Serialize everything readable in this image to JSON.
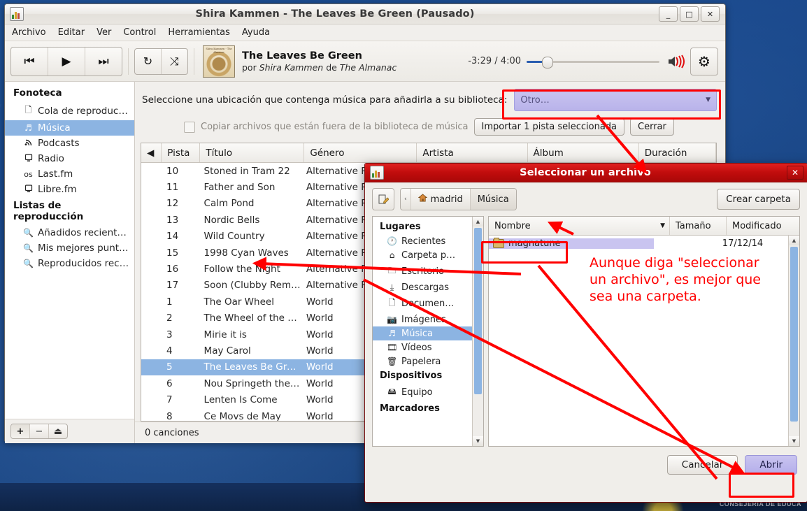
{
  "desktop": {
    "footer_text": "CONSEJERIA DE EDUCA"
  },
  "main_window": {
    "title": "Shira Kammen - The Leaves Be Green (Pausado)",
    "window_buttons": {
      "minimize": "_",
      "maximize": "□",
      "close": "✕"
    },
    "menu": [
      "Archivo",
      "Editar",
      "Ver",
      "Control",
      "Herramientas",
      "Ayuda"
    ],
    "toolbar": {
      "prev": "⏮",
      "play": "▶",
      "next": "⏭",
      "repeat": "↻",
      "shuffle": "⤨",
      "album_art_caption": "Shira Kammen - The Almanac",
      "now_playing_title": "The Leaves Be Green",
      "now_playing_by": "por",
      "now_playing_artist": "Shira Kammen",
      "now_playing_de": "de",
      "now_playing_album": "The Almanac",
      "time": "-3:29 / 4:00",
      "gear": "⚙"
    },
    "sidebar": {
      "section_library": "Fonoteca",
      "library_items": [
        {
          "label": "Cola de reproduc…",
          "icon": "page-icon",
          "glyph": "🗋",
          "selected": false
        },
        {
          "label": "Música",
          "icon": "music-note-icon",
          "glyph": "♬",
          "selected": true
        },
        {
          "label": "Podcasts",
          "icon": "rss-icon",
          "glyph": "🔊",
          "selected": false
        },
        {
          "label": "Radio",
          "icon": "radio-icon",
          "glyph": "🖳",
          "selected": false
        },
        {
          "label": "Last.fm",
          "icon": "lastfm-icon",
          "glyph": "ᴏs",
          "selected": false
        },
        {
          "label": "Libre.fm",
          "icon": "librefm-icon",
          "glyph": "🖳",
          "selected": false
        }
      ],
      "section_playlists": "Listas de reproducción",
      "playlist_items": [
        {
          "label": "Añadidos recient…",
          "icon": "search-icon",
          "glyph": "🔍"
        },
        {
          "label": "Mis mejores punt…",
          "icon": "search-icon",
          "glyph": "🔍"
        },
        {
          "label": "Reproducidos rec…",
          "icon": "search-icon",
          "glyph": "🔍"
        }
      ],
      "footer_buttons": [
        {
          "label": "+",
          "name": "add-playlist-button"
        },
        {
          "label": "−",
          "name": "remove-playlist-button"
        },
        {
          "label": "⏏",
          "name": "eject-button"
        }
      ]
    },
    "import_bar": {
      "prompt": "Seleccione una ubicación que contenga música para añadirla a su biblioteca:",
      "location_value": "Otro…",
      "checkbox_label": "Copiar archivos que están fuera de la biblioteca de música",
      "import_button": "Importar 1 pista seleccionada",
      "close_button": "Cerrar"
    },
    "track_table": {
      "columns": [
        "Pista",
        "Título",
        "Género",
        "Artista",
        "Álbum",
        "Duración"
      ],
      "rows": [
        {
          "no": "10",
          "title": "Stoned in Tram 22",
          "genre": "Alternative Ro",
          "selected": false
        },
        {
          "no": "11",
          "title": "Father and Son",
          "genre": "Alternative Ro",
          "selected": false
        },
        {
          "no": "12",
          "title": "Calm Pond",
          "genre": "Alternative Ro",
          "selected": false
        },
        {
          "no": "13",
          "title": "Nordic Bells",
          "genre": "Alternative Ro",
          "selected": false
        },
        {
          "no": "14",
          "title": "Wild Country",
          "genre": "Alternative Ro",
          "selected": false
        },
        {
          "no": "15",
          "title": "1998 Cyan Waves",
          "genre": "Alternative Ro",
          "selected": false
        },
        {
          "no": "16",
          "title": "Follow the Night",
          "genre": "Alternative Ro",
          "selected": false
        },
        {
          "no": "17",
          "title": "Soon (Clubby Remix)",
          "genre": "Alternative Ro",
          "selected": false
        },
        {
          "no": "1",
          "title": "The Oar Wheel",
          "genre": "World",
          "selected": false
        },
        {
          "no": "2",
          "title": "The Wheel of the Y…",
          "genre": "World",
          "selected": false
        },
        {
          "no": "3",
          "title": "Mirie it is",
          "genre": "World",
          "selected": false
        },
        {
          "no": "4",
          "title": "May Carol",
          "genre": "World",
          "selected": false
        },
        {
          "no": "5",
          "title": "The Leaves Be Green",
          "genre": "World",
          "selected": true
        },
        {
          "no": "6",
          "title": "Nou Springeth the …",
          "genre": "World",
          "selected": false
        },
        {
          "no": "7",
          "title": "Lenten Is Come",
          "genre": "World",
          "selected": false
        },
        {
          "no": "8",
          "title": "Ce Movs de May",
          "genre": "World",
          "selected": false
        }
      ]
    },
    "status": "0 canciones"
  },
  "file_dialog": {
    "title": "Seleccionar un archivo",
    "close": "✕",
    "create_folder_button": "Crear carpeta",
    "breadcrumbs": [
      {
        "label": "‹",
        "icon": "chevron-left-icon",
        "current": false
      },
      {
        "label": "madrid",
        "icon": "home-icon",
        "current": false
      },
      {
        "label": "Música",
        "icon": "",
        "current": true
      }
    ],
    "places": {
      "section_places": "Lugares",
      "items": [
        {
          "label": "Recientes",
          "glyph": "🕐",
          "selected": false
        },
        {
          "label": "Carpeta p…",
          "glyph": "⌂",
          "selected": false
        },
        {
          "label": "Escritorio",
          "glyph": "🗀",
          "selected": false
        },
        {
          "label": "Descargas",
          "glyph": "⤓",
          "selected": false
        },
        {
          "label": "Documen…",
          "glyph": "🗋",
          "selected": false
        },
        {
          "label": "Imágenes",
          "glyph": "📷",
          "selected": false
        },
        {
          "label": "Música",
          "glyph": "♬",
          "selected": true
        },
        {
          "label": "Vídeos",
          "glyph": "🎞",
          "selected": false
        },
        {
          "label": "Papelera",
          "glyph": "🗑",
          "selected": false
        }
      ],
      "section_devices": "Dispositivos",
      "device_items": [
        {
          "label": "Equipo",
          "glyph": "🖴"
        }
      ],
      "section_bookmarks": "Marcadores"
    },
    "file_list": {
      "columns": [
        "Nombre",
        "Tamaño",
        "Modificado"
      ],
      "rows": [
        {
          "name": "magnatune",
          "size": "",
          "modified": "17/12/14",
          "selected": true
        }
      ]
    },
    "buttons": {
      "cancel": "Cancelar",
      "open": "Abrir"
    }
  },
  "annotations": {
    "note_line1": "Aunque diga \"seleccionar",
    "note_line2": "un archivo\", es mejor que",
    "note_line3": "sea una carpeta.",
    "color": "#ff0000"
  }
}
